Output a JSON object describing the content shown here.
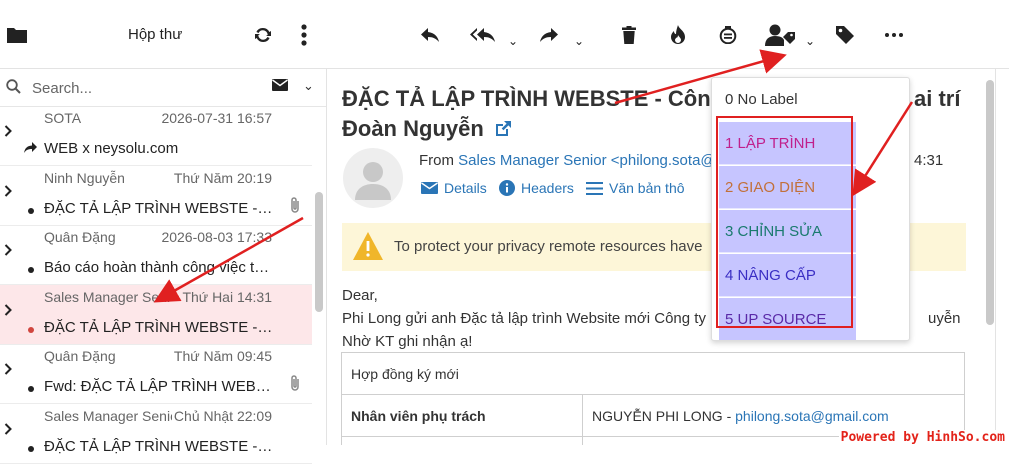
{
  "toolbar": {
    "folder_title": "Hộp thư",
    "icons": [
      "folder-icon",
      "refresh-icon",
      "more-vertical-icon",
      "reply-icon",
      "reply-all-icon",
      "forward-icon",
      "delete-icon",
      "junk-icon",
      "archive-icon",
      "user-tag-icon",
      "tag-icon",
      "more-horizontal-icon"
    ]
  },
  "search": {
    "placeholder": "Search..."
  },
  "messages": [
    {
      "from": "SOTA",
      "date": "2026-07-31 16:57",
      "subject": "WEB x neysolu.com",
      "forwarded": true,
      "attachment": false,
      "unread": false
    },
    {
      "from": "Ninh Nguyễn",
      "date": "Thứ Năm 20:19",
      "subject": "ĐẶC TẢ LẬP TRÌNH WEBSTE - Công ty",
      "forwarded": false,
      "attachment": true,
      "unread": true
    },
    {
      "from": "Quân Đặng",
      "date": "2026-08-03 17:33",
      "subject": "Báo cáo hoàn thành công việc tuần",
      "forwarded": false,
      "attachment": false,
      "unread": true
    },
    {
      "from": "Sales Manager Senior",
      "date": "Thứ Hai 14:31",
      "subject": "ĐẶC TẢ LẬP TRÌNH WEBSTE - Công ty",
      "forwarded": false,
      "attachment": false,
      "unread": true,
      "selected": true
    },
    {
      "from": "Quân Đặng",
      "date": "Thứ Năm 09:45",
      "subject": "Fwd: ĐẶC TẢ LẬP TRÌNH WEBSITE",
      "forwarded": false,
      "attachment": true,
      "unread": true
    },
    {
      "from": "Sales Manager Senior",
      "date": "Chủ Nhật 22:09",
      "subject": "ĐẶC TẢ LẬP TRÌNH WEBSTE - Công ty",
      "forwarded": false,
      "attachment": false,
      "unread": true
    }
  ],
  "email": {
    "subject_line1": "ĐẶC TẢ LẬP TRÌNH WEBSTE - Công",
    "subject_line1_tail": "ai trí",
    "subject_line2": "Đoàn Nguyễn",
    "from_label": "From",
    "from_name": "Sales Manager Senior <philong.sota@",
    "time": "4:31",
    "links": {
      "details": "Details",
      "headers": "Headers",
      "plaintext": "Văn bản thô"
    },
    "privacy_notice": "To protect your privacy remote resources have",
    "greeting": "Dear,",
    "body_line1": "Phi Long gửi anh Đặc tả lập trình Website mới Công ty",
    "body_line1_tail": "uyễn",
    "body_line2": "Nhờ KT ghi nhận ạ!",
    "table": {
      "row1": "Hợp đồng ký mới",
      "row2_label": "Nhân viên phụ trách",
      "row2_value": "NGUYỄN PHI LONG - ",
      "row2_email": "philong.sota@gmail.com"
    }
  },
  "label_menu": {
    "no_label": "0 No Label",
    "items": [
      {
        "label": "1 LẬP TRÌNH",
        "color": "#c0208c"
      },
      {
        "label": "2 GIAO DIỆN",
        "color": "#c2703a"
      },
      {
        "label": "3 CHỈNH SỬA",
        "color": "#1a7a6e"
      },
      {
        "label": "4 NÂNG CẤP",
        "color": "#3a2ec4"
      },
      {
        "label": "5 UP SOURCE",
        "color": "#5a2aa8"
      }
    ]
  },
  "watermark": "Powered by HinhSo.com",
  "colors": {
    "accent": "#2a75b6",
    "selected_row": "#fde7e9",
    "label_bg": "#c6c5ff",
    "annotation": "#e02020"
  }
}
